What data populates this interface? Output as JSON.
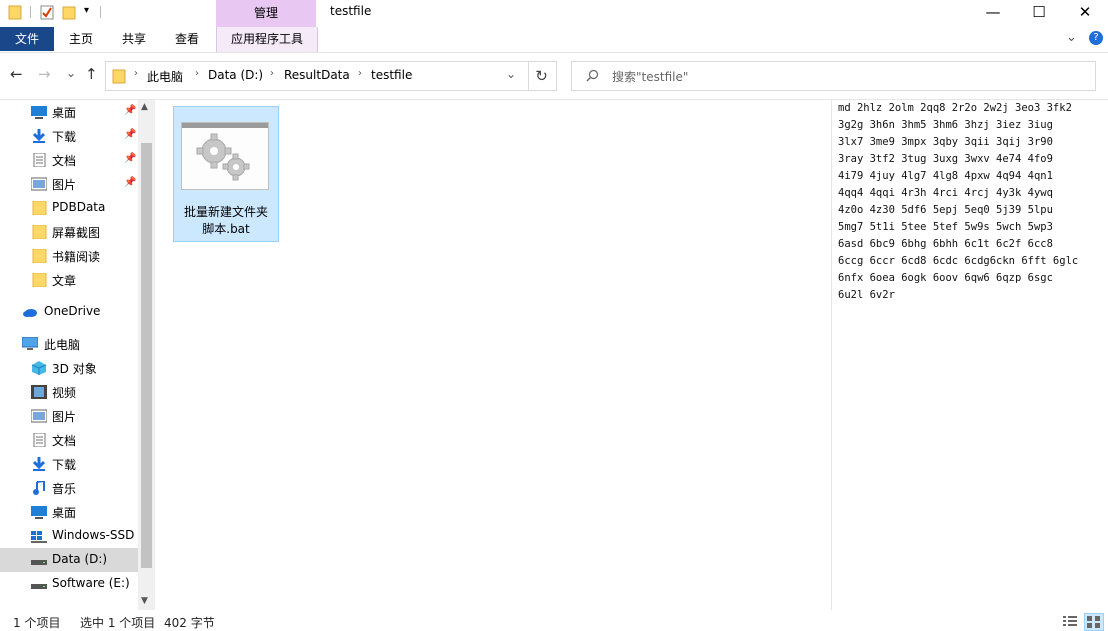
{
  "window": {
    "title": "testfile",
    "context_tab_header": "管理",
    "controls": {
      "minimize": "—",
      "maximize": "☐",
      "close": "✕"
    }
  },
  "ribbon": {
    "tabs": [
      "文件",
      "主页",
      "共享",
      "查看",
      "应用程序工具"
    ],
    "collapse": "⌄",
    "help": "?"
  },
  "navigation": {
    "back": "←",
    "forward": "→",
    "recent": "⌄",
    "up": "↑",
    "breadcrumb": [
      "此电脑",
      "Data (D:)",
      "ResultData",
      "testfile"
    ],
    "dropdown": "⌄",
    "refresh": "↻"
  },
  "search": {
    "placeholder": "搜索\"testfile\"",
    "icon": "search-icon"
  },
  "sidebar": {
    "quick_access": [
      {
        "label": "桌面",
        "icon": "desktop-icon",
        "pinned": true
      },
      {
        "label": "下载",
        "icon": "download-icon",
        "pinned": true
      },
      {
        "label": "文档",
        "icon": "documents-icon",
        "pinned": true
      },
      {
        "label": "图片",
        "icon": "pictures-icon",
        "pinned": true
      },
      {
        "label": "PDBData",
        "icon": "folder-icon",
        "pinned": false
      },
      {
        "label": "屏幕截图",
        "icon": "folder-icon",
        "pinned": false
      },
      {
        "label": "书籍阅读",
        "icon": "folder-icon",
        "pinned": false
      },
      {
        "label": "文章",
        "icon": "folder-icon",
        "pinned": false
      }
    ],
    "onedrive": "OneDrive",
    "this_pc": "此电脑",
    "pc_items": [
      {
        "label": "3D 对象",
        "icon": "3d-objects-icon"
      },
      {
        "label": "视频",
        "icon": "videos-icon"
      },
      {
        "label": "图片",
        "icon": "pictures-icon"
      },
      {
        "label": "文档",
        "icon": "documents-icon"
      },
      {
        "label": "下载",
        "icon": "download-icon"
      },
      {
        "label": "音乐",
        "icon": "music-icon"
      },
      {
        "label": "桌面",
        "icon": "desktop-icon"
      },
      {
        "label": "Windows-SSD",
        "icon": "drive-icon"
      },
      {
        "label": "Data (D:)",
        "icon": "drive-icon",
        "selected": true
      },
      {
        "label": "Software (E:)",
        "icon": "drive-icon"
      }
    ]
  },
  "content": {
    "files": [
      {
        "name_line1": "批量新建文件夹",
        "name_line2": "脚本.bat",
        "icon": "batch-file-gears-icon",
        "selected": true
      }
    ]
  },
  "preview": {
    "lines": [
      "md 2hlz 2olm 2qq8 2r2o 2w2j 3eo3 3fk2",
      "3g2g 3h6n 3hm5 3hm6 3hzj 3iez 3iug",
      "3lx7 3me9 3mpx 3qby 3qii 3qij 3r90",
      "3ray 3tf2 3tug 3uxg 3wxv 4e74 4fo9",
      "4i79 4juy 4lg7 4lg8 4pxw 4q94 4qn1",
      "4qq4 4qqi 4r3h 4rci 4rcj 4y3k 4ywq",
      "4z0o 4z30 5df6 5epj 5eq0 5j39 5lpu",
      "5mg7 5t1i 5tee 5tef 5w9s 5wch 5wp3",
      "6asd 6bc9 6bhg 6bhh 6c1t 6c2f 6cc8",
      "6ccg 6ccr 6cd8 6cdc 6cdg6ckn 6fft 6glc",
      "6nfx 6oea 6ogk 6oov 6qw6 6qzp 6sgc",
      "6u2l 6v2r"
    ]
  },
  "status": {
    "items": "1 个项目",
    "selected": "选中 1 个项目",
    "size": "402 字节"
  },
  "colors": {
    "file_tab": "#19478a",
    "context_tab": "#e8c8f2",
    "selection": "#cce8ff",
    "folder": "#ffd766"
  }
}
